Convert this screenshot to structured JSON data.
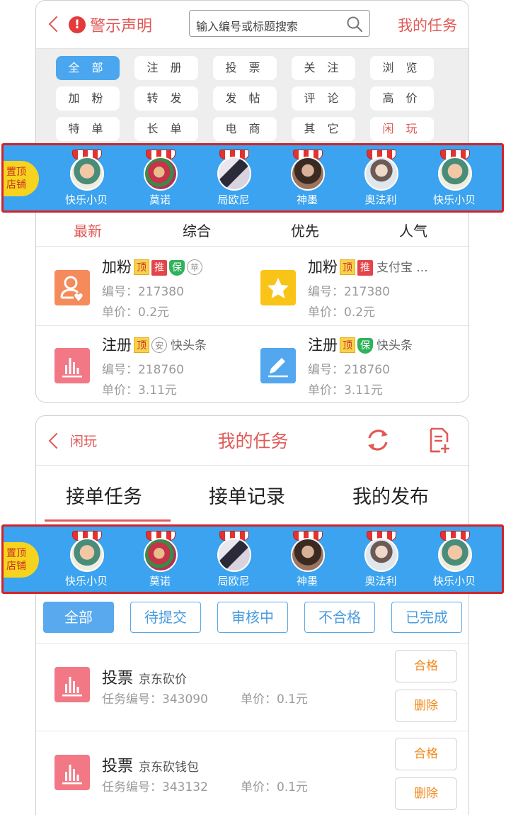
{
  "top": {
    "header": {
      "warning_label": "警示声明",
      "search_placeholder": "输入编号或标题搜索",
      "my_tasks_link": "我的任务"
    },
    "categories": [
      "全 部",
      "注 册",
      "投 票",
      "关 注",
      "浏 览",
      "加 粉",
      "转 发",
      "发 帖",
      "评 论",
      "高 价",
      "特 单",
      "长 单",
      "电 商",
      "其 它",
      "闲 玩"
    ],
    "active_category": "全 部",
    "sort_tabs": [
      "最新",
      "综合",
      "优先",
      "人气"
    ],
    "active_sort": "最新",
    "tasks": [
      {
        "title": "加粉",
        "badges": [
          "顶",
          "推",
          "保",
          "苹"
        ],
        "platform": "",
        "id_line": "编号：217380",
        "price_line": "单价：0.2元",
        "icon": "user-heart-icon",
        "icon_color": "#f58a5b"
      },
      {
        "title": "加粉",
        "badges": [
          "顶",
          "推"
        ],
        "platform": "支付宝 ...",
        "id_line": "编号：217380",
        "price_line": "单价：0.2元",
        "icon": "star-icon",
        "icon_color": "#f9c417"
      },
      {
        "title": "注册",
        "badges": [
          "顶",
          "安"
        ],
        "platform": "快头条",
        "id_line": "编号：218760",
        "price_line": "单价：3.11元",
        "icon": "bar-chart-icon",
        "icon_color": "#f27886"
      },
      {
        "title": "注册",
        "badges": [
          "顶",
          "保"
        ],
        "platform": "快头条",
        "id_line": "编号：218760",
        "price_line": "单价：3.11元",
        "icon": "pencil-icon",
        "icon_color": "#52a7ef"
      }
    ]
  },
  "shop_banner": {
    "pin_label": [
      "置顶",
      "店铺"
    ],
    "shops": [
      "快乐小贝",
      "莫诺",
      "局欧尼",
      "神墨",
      "奥法利",
      "快乐小贝"
    ]
  },
  "bottom": {
    "header": {
      "back_label": "闲玩",
      "title": "我的任务"
    },
    "tabs": [
      "接单任务",
      "接单记录",
      "我的发布"
    ],
    "active_tab": "接单任务",
    "filters": [
      "全部",
      "待提交",
      "审核中",
      "不合格",
      "已完成"
    ],
    "active_filter": "全部",
    "orders": [
      {
        "title": "投票",
        "subtitle": "京东砍价",
        "id_line": "任务编号：343090",
        "price_line": "单价：0.1元",
        "btn_ok": "合格",
        "btn_delete": "删除"
      },
      {
        "title": "投票",
        "subtitle": "京东砍钱包",
        "id_line": "任务编号：343132",
        "price_line": "单价：0.1元",
        "btn_ok": "合格",
        "btn_delete": "删除"
      }
    ]
  },
  "colors": {
    "accent_red": "#e05a57",
    "banner_blue": "#3ba3ef",
    "frame_red": "#d32228",
    "filter_blue": "#4a9bdc",
    "button_orange": "#f08a1d"
  }
}
